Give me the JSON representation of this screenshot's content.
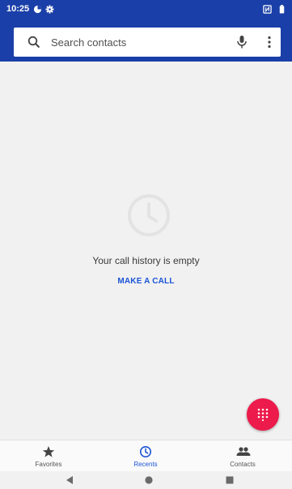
{
  "status_bar": {
    "time": "10:25",
    "background": "#1a3fa8",
    "icons": [
      "data-saver-icon",
      "settings-gear-icon",
      "nfc-icon",
      "battery-icon"
    ]
  },
  "search": {
    "placeholder": "Search contacts",
    "value": "",
    "icons": [
      "search-icon",
      "mic-icon",
      "more-vert-icon"
    ]
  },
  "empty_state": {
    "icon": "clock-icon",
    "message": "Your call history is empty",
    "action_label": "MAKE A CALL"
  },
  "fab": {
    "icon": "dialpad-icon",
    "color": "#ec1b4b"
  },
  "bottom_nav": {
    "items": [
      {
        "label": "Favorites",
        "icon": "star-icon",
        "active": false
      },
      {
        "label": "Recents",
        "icon": "clock-icon",
        "active": true
      },
      {
        "label": "Contacts",
        "icon": "people-icon",
        "active": false
      }
    ],
    "active_color": "#1a53d6"
  },
  "system_nav": {
    "buttons": [
      "back-icon",
      "home-icon",
      "recents-icon"
    ]
  }
}
